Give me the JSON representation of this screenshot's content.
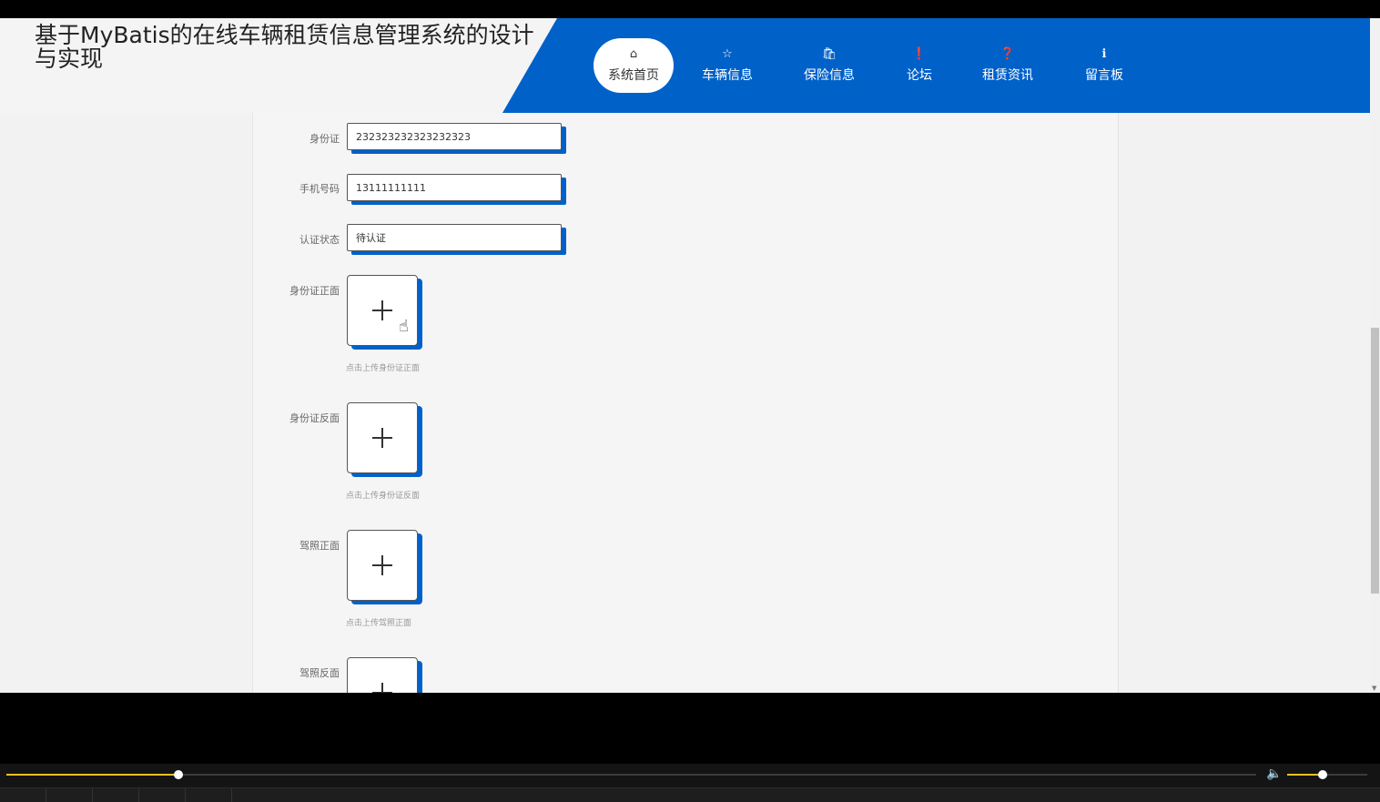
{
  "header": {
    "title": "基于MyBatis的在线车辆租赁信息管理系统的设计与实现",
    "nav": [
      {
        "label": "系统首页",
        "icon": "home-icon",
        "active": true
      },
      {
        "label": "车辆信息",
        "icon": "star-icon",
        "active": false
      },
      {
        "label": "保险信息",
        "icon": "bag-icon",
        "active": false
      },
      {
        "label": "论坛",
        "icon": "exclamation-icon",
        "active": false
      },
      {
        "label": "租赁资讯",
        "icon": "question-icon",
        "active": false
      },
      {
        "label": "留言板",
        "icon": "info-icon",
        "active": false
      }
    ]
  },
  "form": {
    "id_card": {
      "label": "身份证",
      "value": "232323232323232323"
    },
    "phone": {
      "label": "手机号码",
      "value": "13111111111"
    },
    "auth_status": {
      "label": "认证状态",
      "value": "待认证"
    },
    "id_front": {
      "label": "身份证正面",
      "hint": "点击上传身份证正面"
    },
    "id_back": {
      "label": "身份证反面",
      "hint": "点击上传身份证反面"
    },
    "license_front": {
      "label": "驾照正面",
      "hint": "点击上传驾照正面"
    },
    "license_back": {
      "label": "驾照反面"
    }
  },
  "player": {
    "progress": 0.138,
    "volume": 0.44
  },
  "colors": {
    "accent": "#0061c9",
    "progress": "#f0c020"
  }
}
